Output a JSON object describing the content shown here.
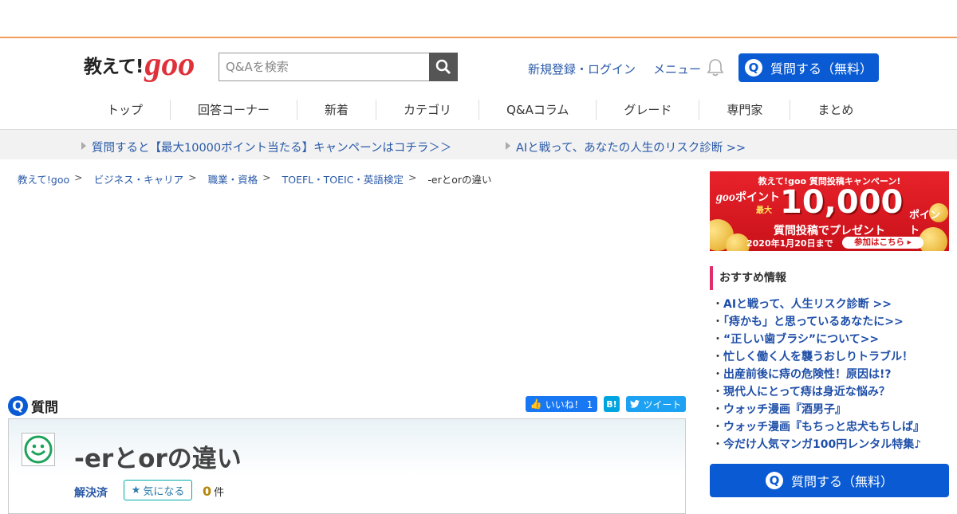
{
  "header": {
    "logo_text": "教えて!",
    "logo_brand": "goo",
    "search_placeholder": "Q&Aを検索",
    "register_login": "新規登録・ログイン",
    "menu": "メニュー",
    "ask_button": "質問する（無料）"
  },
  "nav": [
    "トップ",
    "回答コーナー",
    "新着",
    "カテゴリ",
    "Q&Aコラム",
    "グレード",
    "専門家",
    "まとめ"
  ],
  "promo": {
    "left": "質問すると【最大10000ポイント当たる】キャンペーンはコチラ＞＞",
    "right": "AIと戦って、あなたの人生のリスク診断 >>"
  },
  "breadcrumb": [
    "教えて!goo",
    "ビジネス・キャリア",
    "職業・資格",
    "TOEFL・TOEIC・英語検定",
    "-erとorの違い"
  ],
  "question": {
    "section_label": "質問",
    "title": "-erとorの違い",
    "status": "解決済",
    "watch_label": "気になる",
    "count": "0",
    "count_unit": "件"
  },
  "social": {
    "like": "いいね！ 1",
    "hatena": "B!",
    "tweet": "ツイート"
  },
  "banner": {
    "line1": "教えて!goo 質問投稿キャンペーン!",
    "brand": "goo",
    "points_label": "ポイント",
    "max": "最大",
    "amount": "10,000",
    "unit": "ポイント",
    "line3": "質問投稿でプレゼント",
    "deadline": "2020年1月20日まで",
    "cta": "参加はこちら ▸"
  },
  "recommend": {
    "title": "おすすめ情報",
    "items": [
      "AIと戦って、人生リスク診断 >>",
      "「痔かも」と思っているあなたに>>",
      "“正しい歯ブラシ”について>>",
      "忙しく働く人を襲うおしりトラブル！",
      "出産前後に痔の危険性！原因は!?",
      "現代人にとって痔は身近な悩み？",
      "ウォッチ漫画『酒男子』",
      "ウォッチ漫画『もちっと忠犬もちしば』",
      "今だけ人気マンガ100円レンタル特集♪"
    ]
  },
  "side_ask_button": "質問する（無料）",
  "colors": {
    "accent": "#0a5bd3",
    "brand_red": "#e0303a",
    "top_border": "#f39c5a"
  }
}
